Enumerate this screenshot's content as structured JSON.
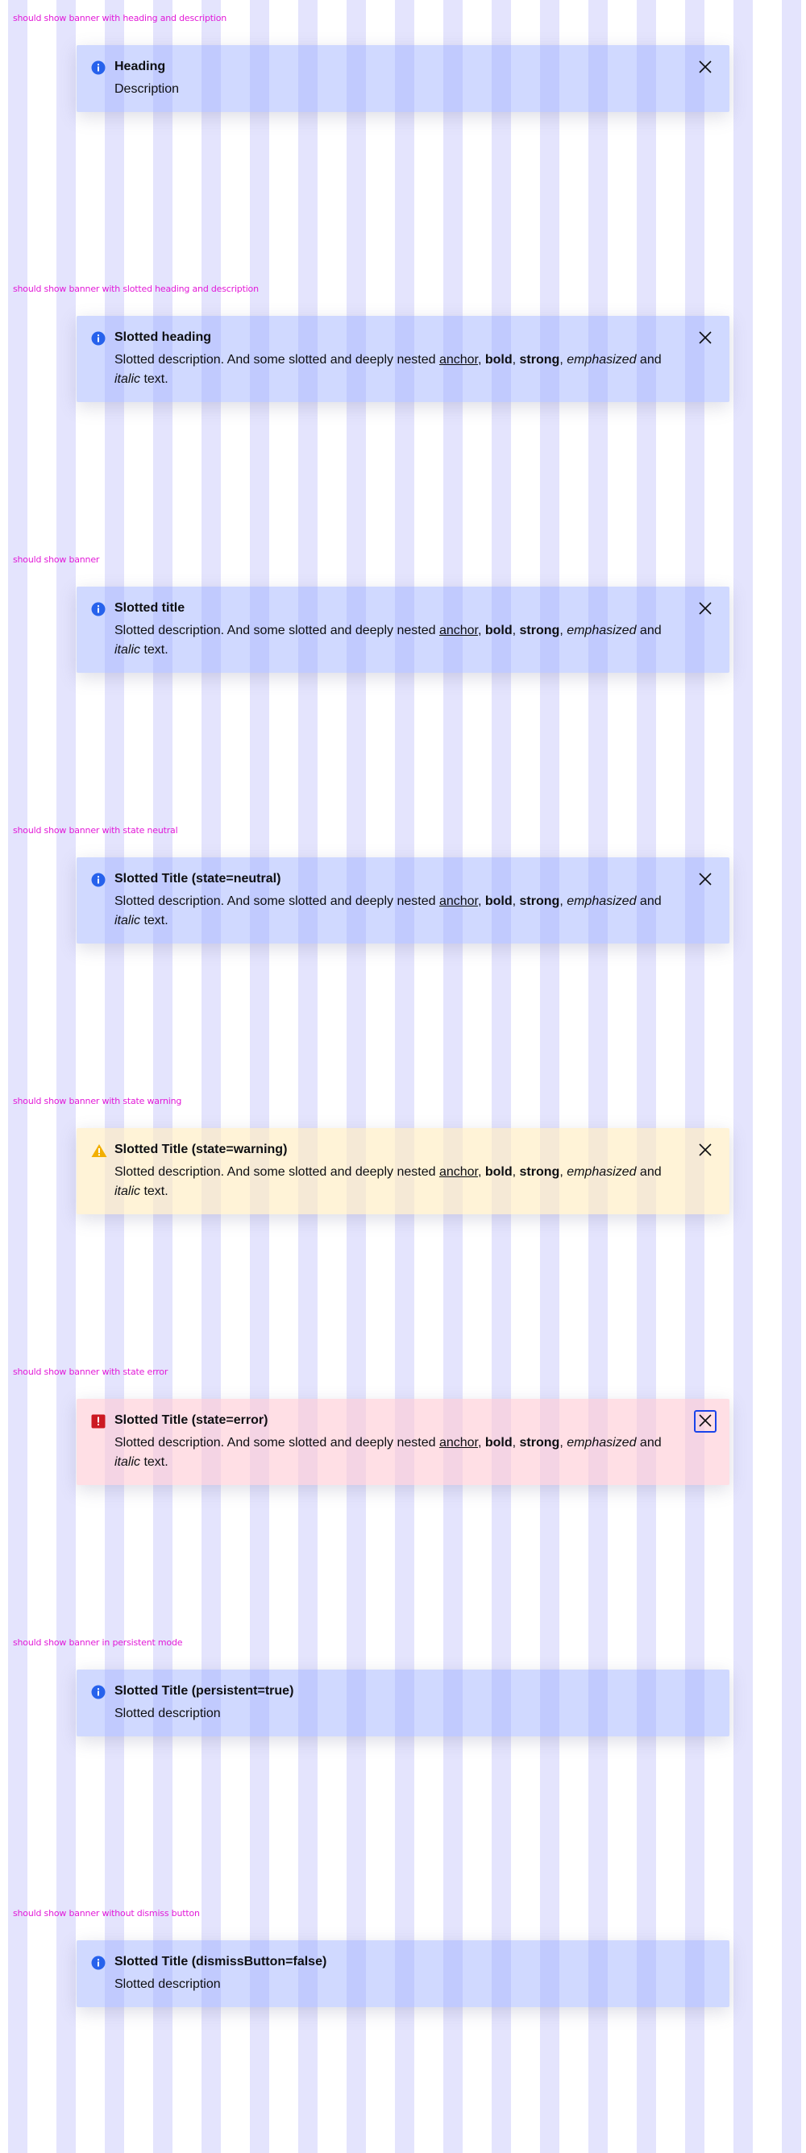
{
  "cases": [
    {
      "label": "should show banner with heading and description",
      "state": "info",
      "title": "Heading",
      "description": "Description",
      "rich": false,
      "dismissible": true
    },
    {
      "label": "should show banner with slotted heading and description",
      "state": "info",
      "title": "Slotted heading",
      "rich": true,
      "dismissible": true
    },
    {
      "label": "should show banner",
      "state": "info",
      "title": "Slotted title",
      "rich": true,
      "dismissible": true
    },
    {
      "label": "should show banner with state neutral",
      "state": "info",
      "title": "Slotted Title (state=neutral)",
      "rich": true,
      "dismissible": true
    },
    {
      "label": "should show banner with state warning",
      "state": "warning",
      "title": "Slotted Title (state=warning)",
      "rich": true,
      "dismissible": true
    },
    {
      "label": "should show banner with state error",
      "state": "error",
      "title": "Slotted Title (state=error)",
      "rich": true,
      "dismissible": true,
      "dismiss_focused": true
    },
    {
      "label": "should show banner in persistent mode",
      "state": "info",
      "title": "Slotted Title (persistent=true)",
      "description": "Slotted description",
      "rich": false,
      "dismissible": false
    },
    {
      "label": "should show banner without dismiss button",
      "state": "info",
      "title": "Slotted Title (dismissButton=false)",
      "description": "Slotted description",
      "rich": false,
      "dismissible": false
    }
  ],
  "rich_description": {
    "lead": "Slotted description. And some slotted and deeply nested ",
    "anchor": "anchor",
    "sep1": ", ",
    "bold": "bold",
    "sep2": ", ",
    "strong": "strong",
    "sep3": ", ",
    "emphasized": "emphasized",
    "sep4": " and ",
    "italic": "italic",
    "tail": " text."
  },
  "colors": {
    "info_icon": "#2762ec",
    "warning_icon": "#f2af00",
    "error_icon": "#cc1922",
    "label_text": "#e21ad8",
    "focus_ring": "#1a44ea"
  },
  "icons": {
    "info": "information-icon",
    "warning": "warning-icon",
    "error": "error-icon",
    "dismiss": "close-icon"
  }
}
